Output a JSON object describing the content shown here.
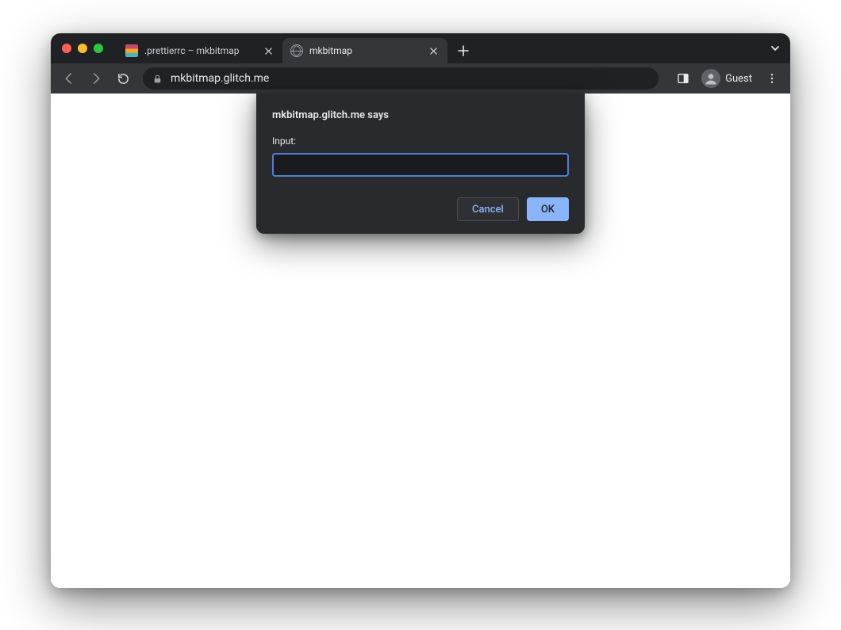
{
  "tabs": [
    {
      "title": ".prettierrc – mkbitmap",
      "active": false
    },
    {
      "title": "mkbitmap",
      "active": true
    }
  ],
  "address": {
    "url": "mkbitmap.glitch.me"
  },
  "profile": {
    "label": "Guest"
  },
  "dialog": {
    "origin_says": "mkbitmap.glitch.me says",
    "label": "Input:",
    "value": "",
    "cancel": "Cancel",
    "ok": "OK"
  }
}
